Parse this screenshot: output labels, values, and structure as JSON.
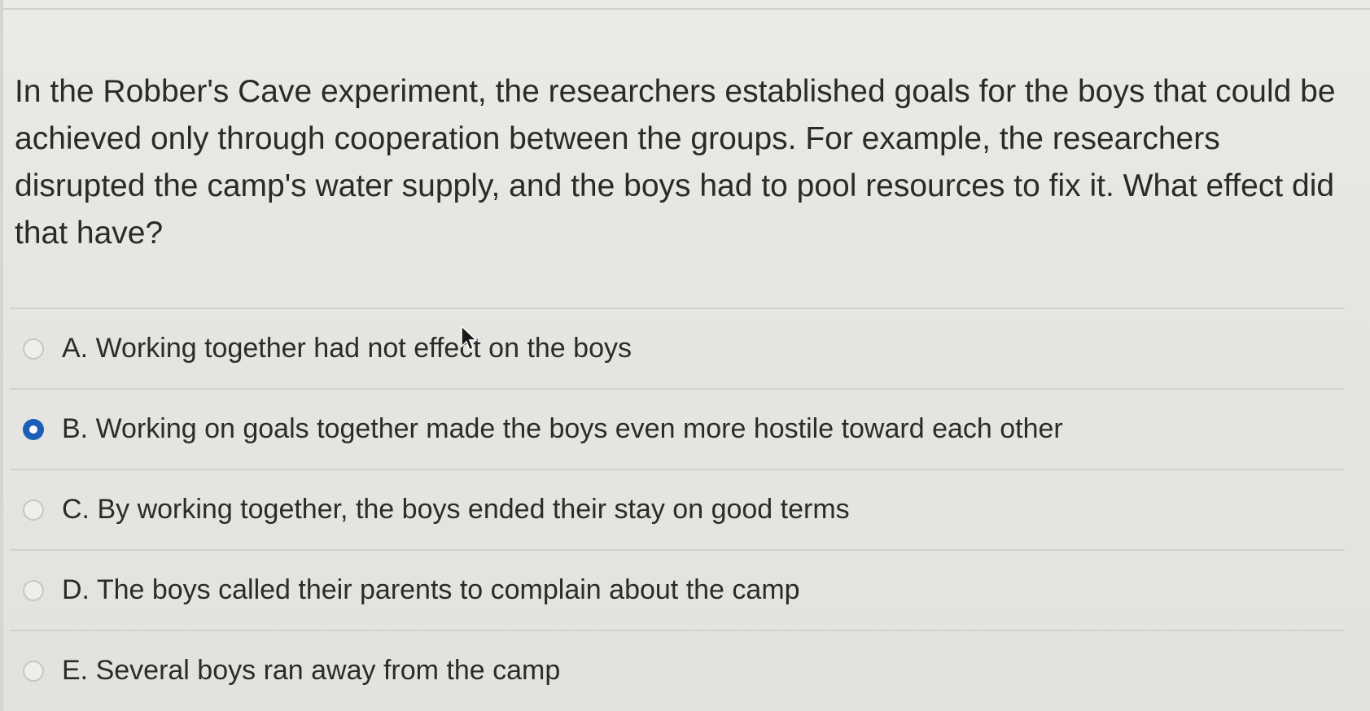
{
  "question": {
    "text": "In the Robber's Cave experiment, the researchers established goals for the boys that could be achieved only through cooperation between the groups.  For example, the researchers disrupted the camp's water supply, and the boys had to pool resources to fix it.  What effect did that have?"
  },
  "options": [
    {
      "label": "A. Working together had not effect on the boys",
      "selected": false
    },
    {
      "label": "B. Working on goals together made the boys even more hostile toward each other",
      "selected": true
    },
    {
      "label": "C. By working together, the boys ended their stay on good terms",
      "selected": false
    },
    {
      "label": "D. The boys called their parents to complain about the camp",
      "selected": false
    },
    {
      "label": "E. Several boys ran away from the camp",
      "selected": false
    }
  ],
  "colors": {
    "selected_radio": "#1c5fb8",
    "text": "#2b2b2b",
    "divider": "#d2d1cc"
  },
  "icons": {
    "cursor": "mouse-pointer-icon",
    "radio": "radio-button-icon"
  }
}
